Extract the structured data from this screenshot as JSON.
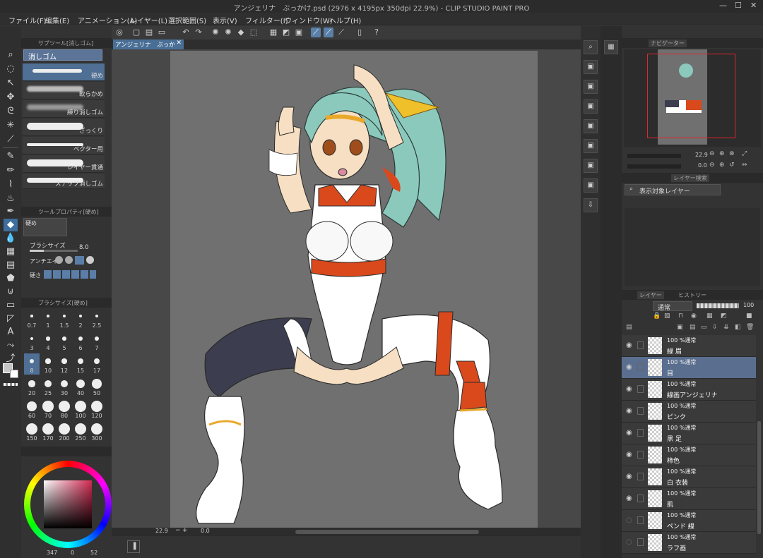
{
  "window": {
    "title": "アンジェリナ　ぶっかけ.psd (2976 x 4195px 350dpi 22.9%)  - CLIP STUDIO PAINT PRO",
    "min": "—",
    "max": "☐",
    "close": "✕"
  },
  "menu": [
    "ファイル(F)",
    "編集(E)",
    "アニメーション(A)",
    "レイヤー(L)",
    "選択範囲(S)",
    "表示(V)",
    "フィルター(I)",
    "ウィンドウ(W)",
    "ヘルプ(H)"
  ],
  "subtool": {
    "header": "サブツール[消しゴム]",
    "group": "消しゴム",
    "brushes": [
      "硬め",
      "軟らかめ",
      "練り消しゴム",
      "ざっくり",
      "ベクター用",
      "レイヤー貫通",
      "スナップ消しゴム"
    ]
  },
  "toolprop": {
    "header": "ツールプロパティ[硬め]",
    "name": "硬め",
    "brush_size_label": "ブラシサイズ",
    "brush_size_value": "8.0",
    "antialias_label": "アンチエイリ",
    "hardness_label": "硬さ"
  },
  "brushsize": {
    "header": "ブラシサイズ[硬め]",
    "sizes": [
      "0.7",
      "1",
      "1.5",
      "2",
      "2.5",
      "3",
      "4",
      "5",
      "6",
      "7",
      "8",
      "10",
      "12",
      "15",
      "17",
      "20",
      "25",
      "30",
      "40",
      "50",
      "60",
      "70",
      "80",
      "100",
      "120",
      "150",
      "170",
      "200",
      "250",
      "300"
    ],
    "selected": "8"
  },
  "color": {
    "accent": "#4f6f95",
    "swatch_main": "#c7c7c7"
  },
  "colorinfo": {
    "a": "347",
    "b": "0",
    "c": "52"
  },
  "canvas": {
    "tab_label": "アンジェリナ　ぶっかけ.psd",
    "zoom": "22.9",
    "rotation": "0.0"
  },
  "navigator": {
    "tab": "ナビゲーター",
    "zoom": "22.9",
    "rotation": "0.0"
  },
  "layersearch": {
    "tab": "レイヤー検索",
    "filter": "表示対象レイヤー"
  },
  "layerpanel": {
    "tab_layer": "レイヤー",
    "tab_history": "ヒストリー",
    "blend": "通常",
    "opacity": "100",
    "layers": [
      {
        "mode": "100 %通常",
        "name": "緑 眉",
        "active": false,
        "visible": true
      },
      {
        "mode": "100 %通常",
        "name": "目",
        "active": true,
        "visible": true
      },
      {
        "mode": "100 %通常",
        "name": "線画アンジェリナ",
        "active": false,
        "visible": true
      },
      {
        "mode": "100 %通常",
        "name": "ピンク",
        "active": false,
        "visible": true
      },
      {
        "mode": "100 %通常",
        "name": "黒 足",
        "active": false,
        "visible": true
      },
      {
        "mode": "100 %通常",
        "name": "柿色",
        "active": false,
        "visible": true
      },
      {
        "mode": "100 %通常",
        "name": "白 衣装",
        "active": false,
        "visible": true
      },
      {
        "mode": "100 %通常",
        "name": "肌",
        "active": false,
        "visible": true
      },
      {
        "mode": "100 %通常",
        "name": "ペンド 線",
        "active": false,
        "visible": false
      },
      {
        "mode": "100 %通常",
        "name": "ラフ画",
        "active": false,
        "visible": false
      }
    ]
  }
}
